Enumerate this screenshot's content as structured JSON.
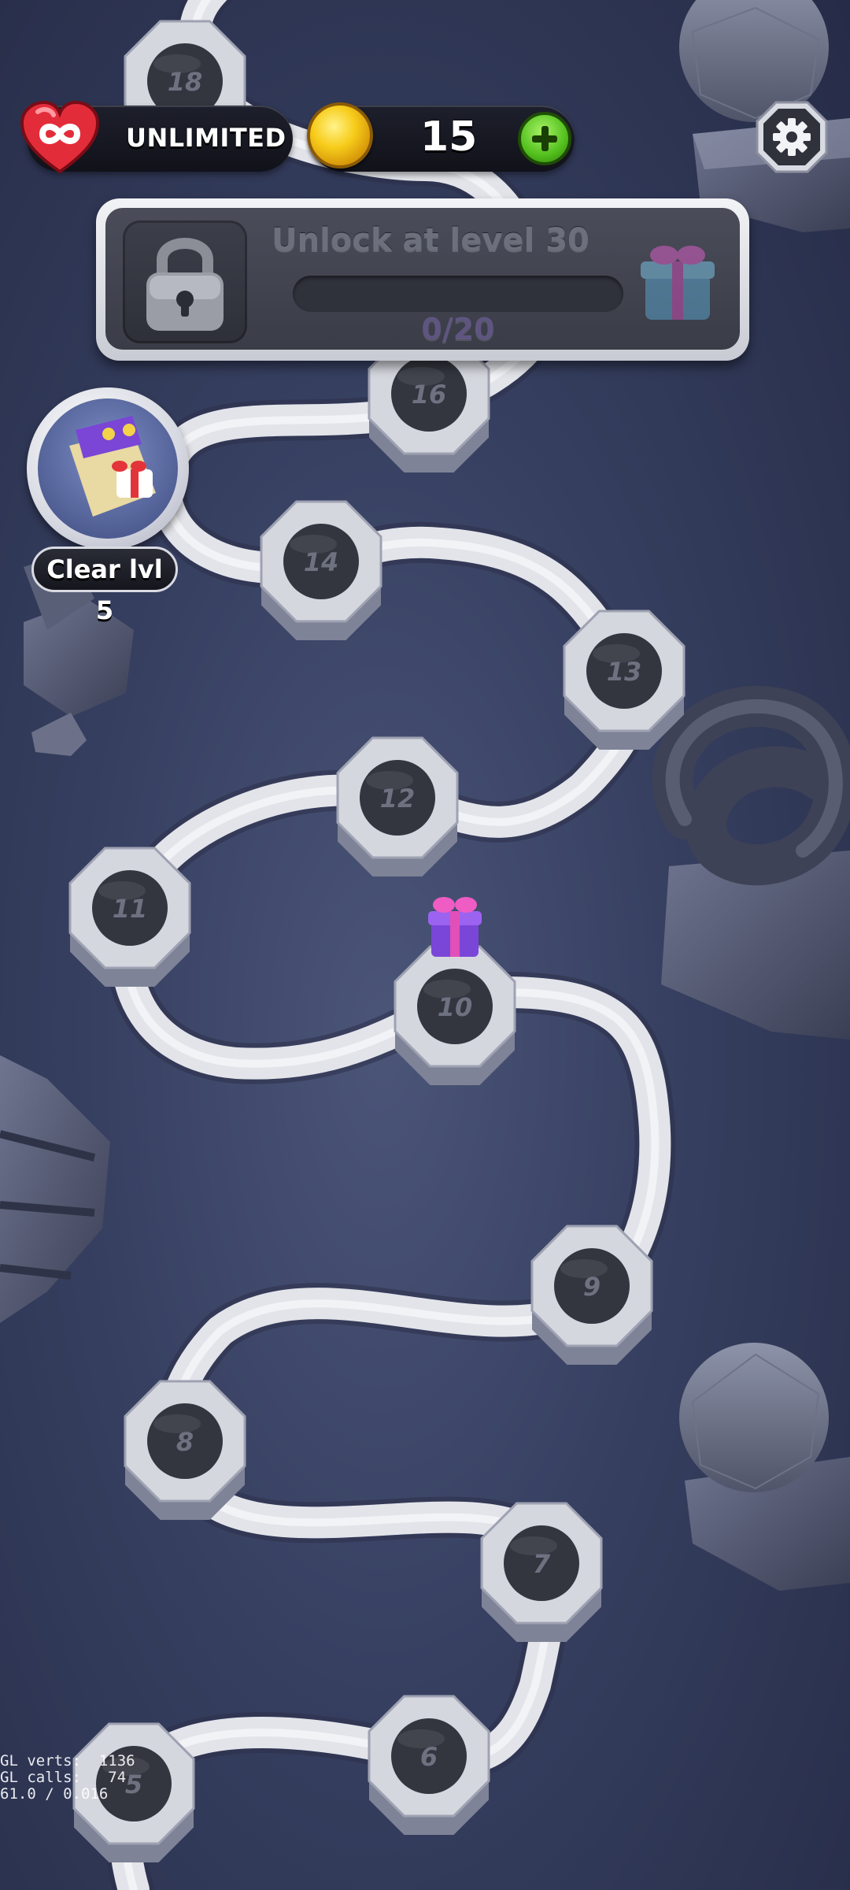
{
  "hud": {
    "lives_text": "UNLIMITED",
    "coins": "15"
  },
  "locked_event": {
    "title": "Unlock at level 30",
    "progress_text": "0/20",
    "progress_fraction": 0
  },
  "side_event": {
    "label": "Clear lvl 5"
  },
  "levels": [
    {
      "number": "5"
    },
    {
      "number": "6"
    },
    {
      "number": "7"
    },
    {
      "number": "8"
    },
    {
      "number": "9"
    },
    {
      "number": "10"
    },
    {
      "number": "11"
    },
    {
      "number": "12"
    },
    {
      "number": "13"
    },
    {
      "number": "14"
    },
    {
      "number": "16"
    },
    {
      "number": "18"
    }
  ],
  "debug": {
    "line1": "GL verts:  1136",
    "line2": "GL calls:   74",
    "line3": "61.0 / 0.016"
  },
  "colors": {
    "background": "#363f60",
    "path": "#e6e7ec",
    "node": "#3a3d48",
    "accent_green": "#52bf1d",
    "coin_gold": "#f7cc1a"
  }
}
